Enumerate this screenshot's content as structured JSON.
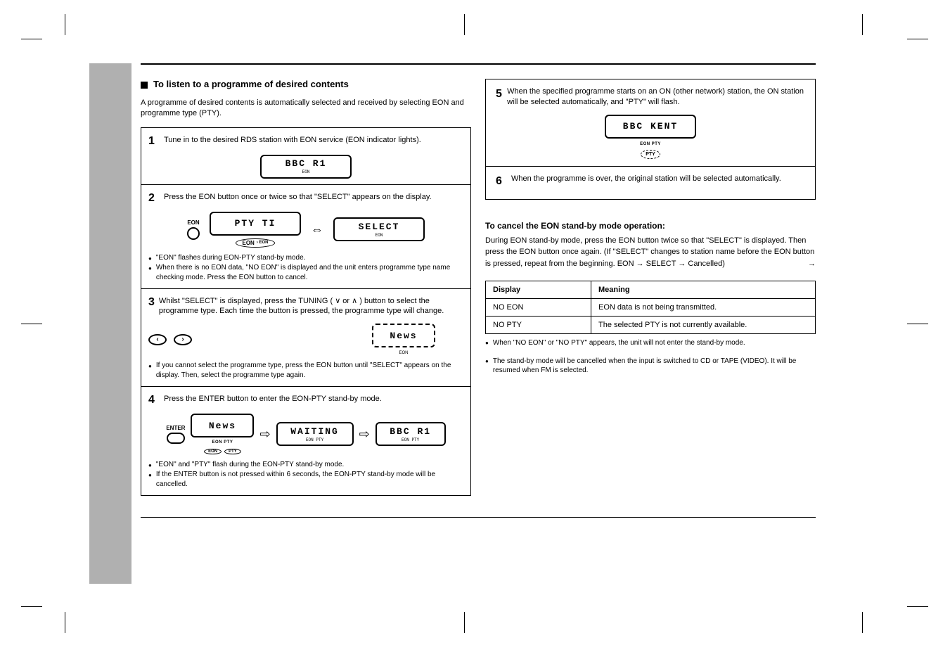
{
  "section": {
    "title": "To listen to a programme of desired contents",
    "subtitle": "A programme of desired contents is automatically selected and received by selecting EON and programme type (PTY)."
  },
  "steps": [
    {
      "num": "1",
      "text": "Tune in to the desired RDS station with EON service (EON indicator lights).",
      "lcd": "BBC R1",
      "lcd_sub": "EON"
    },
    {
      "num": "2",
      "text": "Press the EON button once or twice so that \"SELECT\" appears on the display.",
      "lcd_a": "PTY TI",
      "lcd_b": "SELECT",
      "eon_button_label": "EON",
      "bullets": [
        "\"EON\" flashes during EON-PTY stand-by mode.",
        "When there is no EON data, \"NO EON\" is displayed and the unit enters programme type name checking mode. Press the EON button to cancel."
      ]
    },
    {
      "num": "3",
      "text": "Whilst \"SELECT\" is displayed, press the TUNING ( ∨ or ∧ ) button to select the programme type. Each time the button is pressed, the programme type will change.",
      "lcd_a": "News",
      "lcd_sub": "EON",
      "bullets": [
        "If you cannot select the programme type, press the EON button until \"SELECT\" appears on the display. Then, select the programme type again."
      ]
    },
    {
      "num": "4",
      "text": "Press the ENTER button to enter the EON-PTY stand-by mode.",
      "lcd_a": "News",
      "lcd_b": "WAITING",
      "lcd_c": "BBC R1",
      "enter_label": "ENTER",
      "eon_pill": "EON",
      "pty_pill": "PTY",
      "bullets": [
        "\"EON\" and \"PTY\" flash during the EON-PTY stand-by mode.",
        "If the ENTER button is not pressed within 6 seconds, the EON-PTY stand-by mode will be cancelled."
      ]
    }
  ],
  "right": {
    "box_step5_text": "When the specified programme starts on an ON (other network) station, the ON station will be selected automatically, and \"PTY\" will flash.",
    "box_step5_lcd": "BBC KENT",
    "box_step5_badge_top": "EON PTY",
    "box_step5_badge": "PTY",
    "box_step6_text": "When the programme is over, the original station will be selected automatically.",
    "cancel_head": "To cancel the EON stand-by mode operation:",
    "cancel_text": "During EON stand-by mode, press the EON button twice so that \"SELECT\" is displayed. Then press the EON button once again. (If \"SELECT\" changes to station name before the EON button is pressed, repeat from the beginning. EON → SELECT → Cancelled)",
    "cancel_note": "The stand-by mode will be cancelled when the input is switched to CD or TAPE (VIDEO). It will be resumed when FM is selected.",
    "table": {
      "r1c1": "Display",
      "r1c2": "Meaning",
      "r2c1": "NO EON",
      "r2c2": "EON data is not being transmitted.",
      "r3c1": "NO PTY",
      "r3c2": "The selected PTY is not currently available."
    },
    "table_note": "When \"NO EON\" or \"NO PTY\" appears, the unit will not enter the stand-by mode."
  }
}
